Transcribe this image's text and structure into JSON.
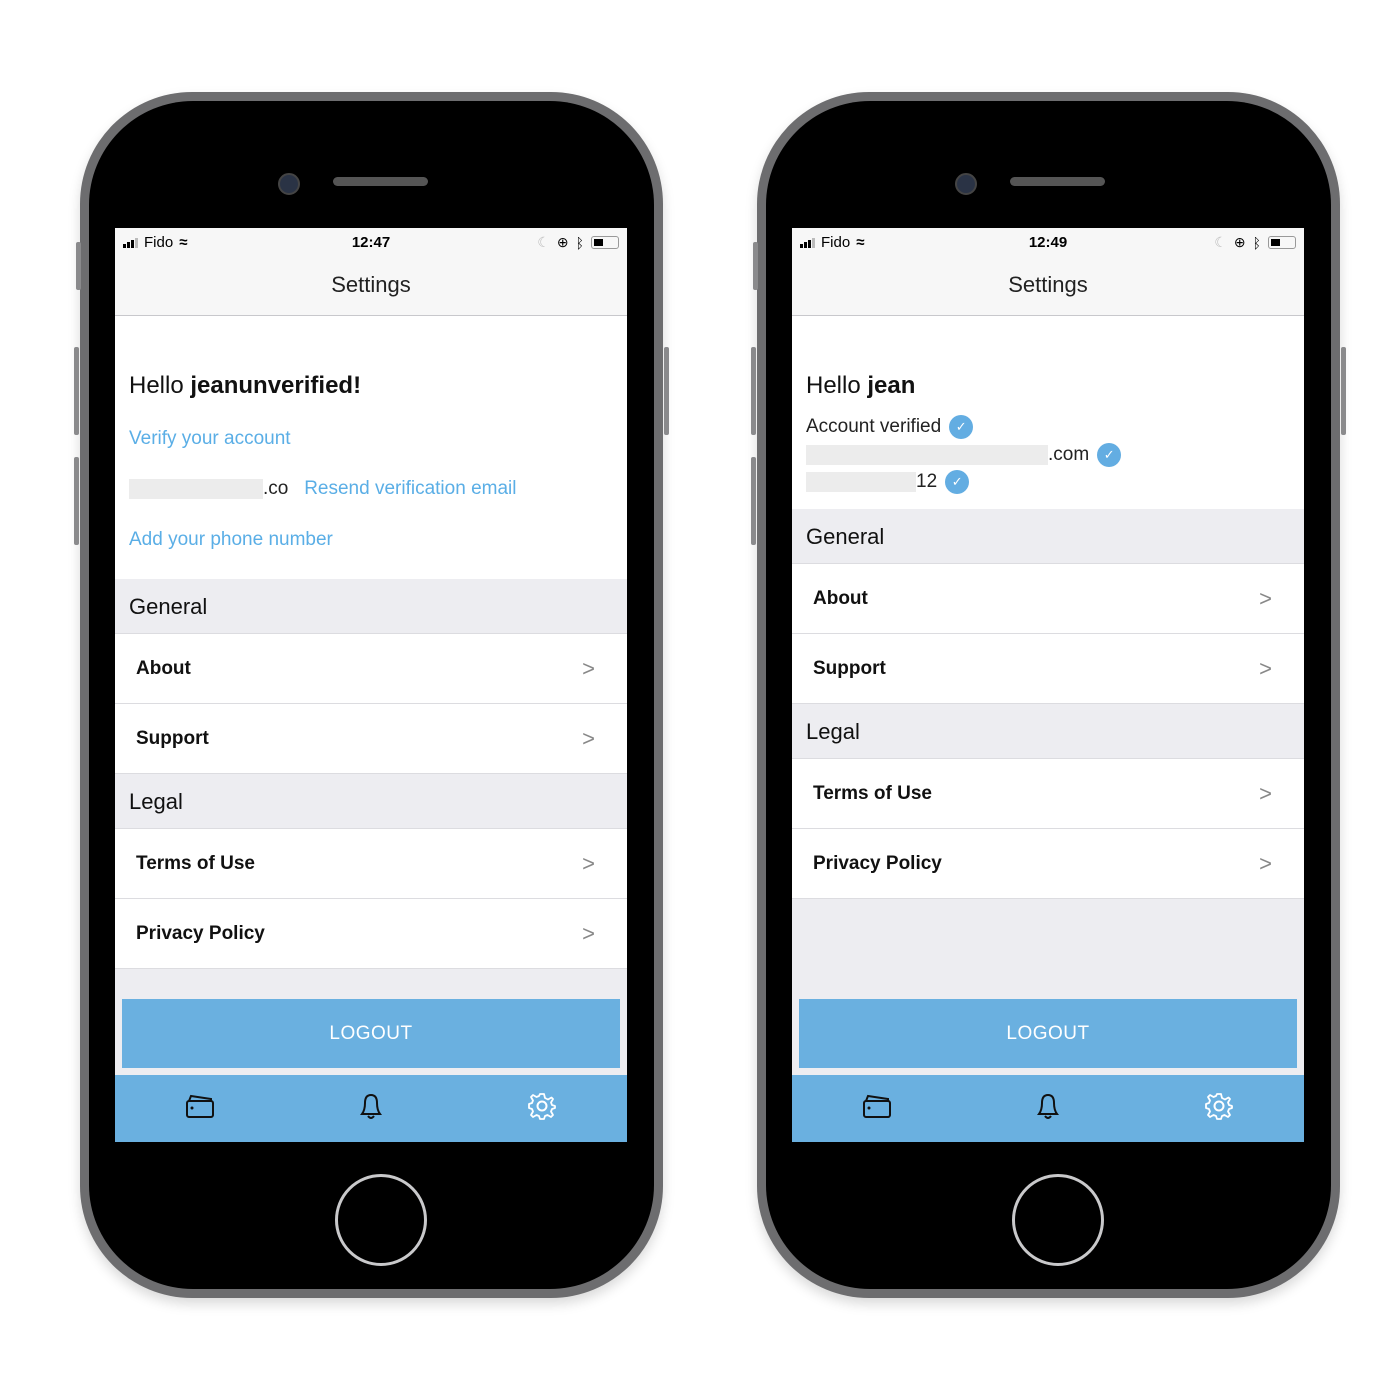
{
  "colors": {
    "accent": "#6ab0e0",
    "link": "#5aaee6",
    "section_bg": "#ededf1"
  },
  "phones": [
    {
      "status": {
        "carrier": "Fido",
        "time": "12:47",
        "battery_percent": 40
      },
      "nav_title": "Settings",
      "greeting_prefix": "Hello ",
      "username": "jeanunverified!",
      "verify_link": "Verify your account",
      "email_suffix": ".co",
      "resend_link": "Resend verification email",
      "phone_link": "Add your phone number",
      "sections": [
        {
          "title": "General",
          "items": [
            "About",
            "Support"
          ]
        },
        {
          "title": "Legal",
          "items": [
            "Terms of Use",
            "Privacy Policy"
          ]
        }
      ],
      "chevron": ">",
      "logout": "LOGOUT",
      "tabs": [
        "wallet-icon",
        "bell-icon",
        "gear-icon"
      ]
    },
    {
      "status": {
        "carrier": "Fido",
        "time": "12:49",
        "battery_percent": 40
      },
      "nav_title": "Settings",
      "greeting_prefix": "Hello ",
      "username": "jean",
      "verified_label": "Account verified",
      "email_suffix": ".com",
      "phone_suffix": "12",
      "sections": [
        {
          "title": "General",
          "items": [
            "About",
            "Support"
          ]
        },
        {
          "title": "Legal",
          "items": [
            "Terms of Use",
            "Privacy Policy"
          ]
        }
      ],
      "chevron": ">",
      "logout": "LOGOUT",
      "tabs": [
        "wallet-icon",
        "bell-icon",
        "gear-icon"
      ]
    }
  ]
}
